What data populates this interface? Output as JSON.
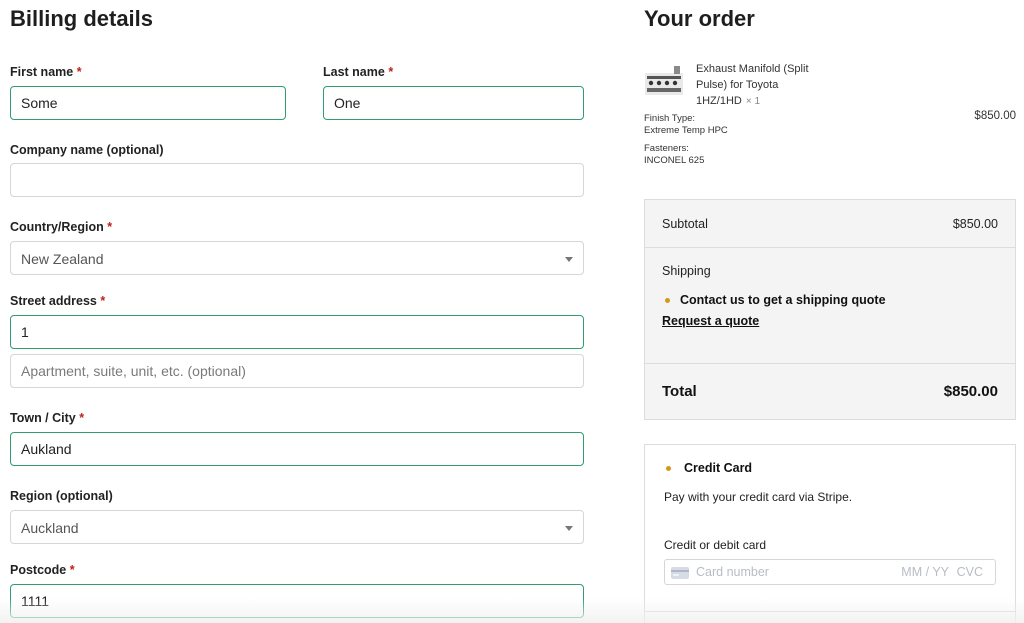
{
  "billing": {
    "title": "Billing details",
    "required_mark": "*",
    "first_name": {
      "label": "First name",
      "value": "Some"
    },
    "last_name": {
      "label": "Last name",
      "value": "One"
    },
    "company": {
      "label": "Company name (optional)",
      "value": ""
    },
    "country": {
      "label": "Country/Region",
      "value": "New Zealand"
    },
    "street": {
      "label": "Street address",
      "value": "1",
      "apt_placeholder": "Apartment, suite, unit, etc. (optional)"
    },
    "city": {
      "label": "Town / City",
      "value": "Aukland"
    },
    "region": {
      "label": "Region (optional)",
      "value": "Auckland"
    },
    "postcode": {
      "label": "Postcode",
      "value": "1111"
    }
  },
  "order": {
    "title": "Your order",
    "item": {
      "name": "Exhaust Manifold (Split Pulse) for Toyota 1HZ/1HD",
      "qty": "× 1",
      "price": "$850.00",
      "finish_label": "Finish Type:",
      "finish_value": "Extreme Temp HPC",
      "fasteners_label": "Fasteners:",
      "fasteners_value": "INCONEL 625"
    },
    "subtotal_label": "Subtotal",
    "subtotal_value": "$850.00",
    "shipping_label": "Shipping",
    "shipping_message": "Contact us to get a shipping quote",
    "quote_link": "Request a quote",
    "total_label": "Total",
    "total_value": "$850.00"
  },
  "payment": {
    "method": "Credit Card",
    "description": "Pay with your credit card via Stripe.",
    "card_label": "Credit or debit card",
    "card_placeholder": "Card number",
    "expiry_placeholder": "MM / YY",
    "cvc_placeholder": "CVC"
  },
  "colors": {
    "valid_border": "#2e9e6e",
    "required": "#c0201a",
    "radio_dot": "#d19a1a"
  }
}
